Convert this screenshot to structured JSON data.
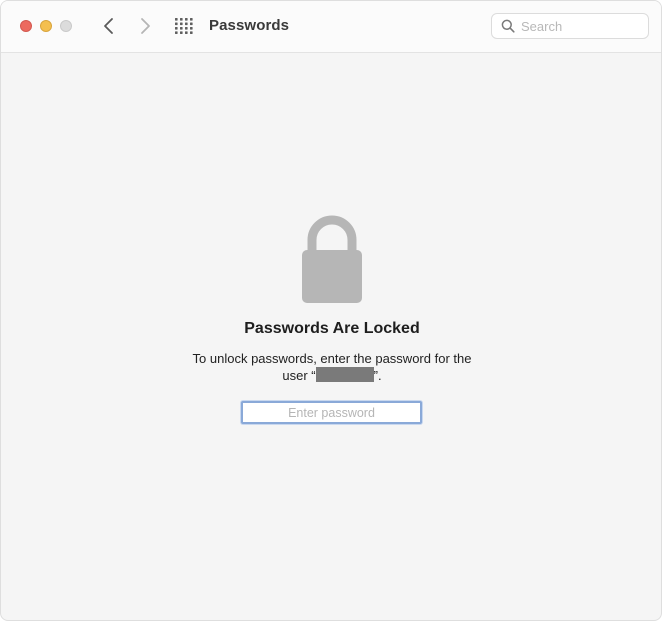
{
  "window": {
    "title": "Passwords"
  },
  "toolbar": {
    "back_icon": "chevron-left-icon",
    "forward_icon": "chevron-right-icon",
    "grid_icon": "show-all-grid-icon"
  },
  "search": {
    "placeholder": "Search",
    "value": ""
  },
  "locked": {
    "icon": "lock-icon",
    "heading": "Passwords Are Locked",
    "message_prefix": "To unlock passwords, enter the password for the user “",
    "message_suffix": "”.",
    "password_placeholder": "Enter password",
    "password_value": ""
  },
  "colors": {
    "close": "#ec6a5f",
    "minimize": "#f4bf4f",
    "zoom": "#dcdcdc",
    "focus_ring": "#8aa9d8",
    "lock": "#b6b6b6"
  }
}
